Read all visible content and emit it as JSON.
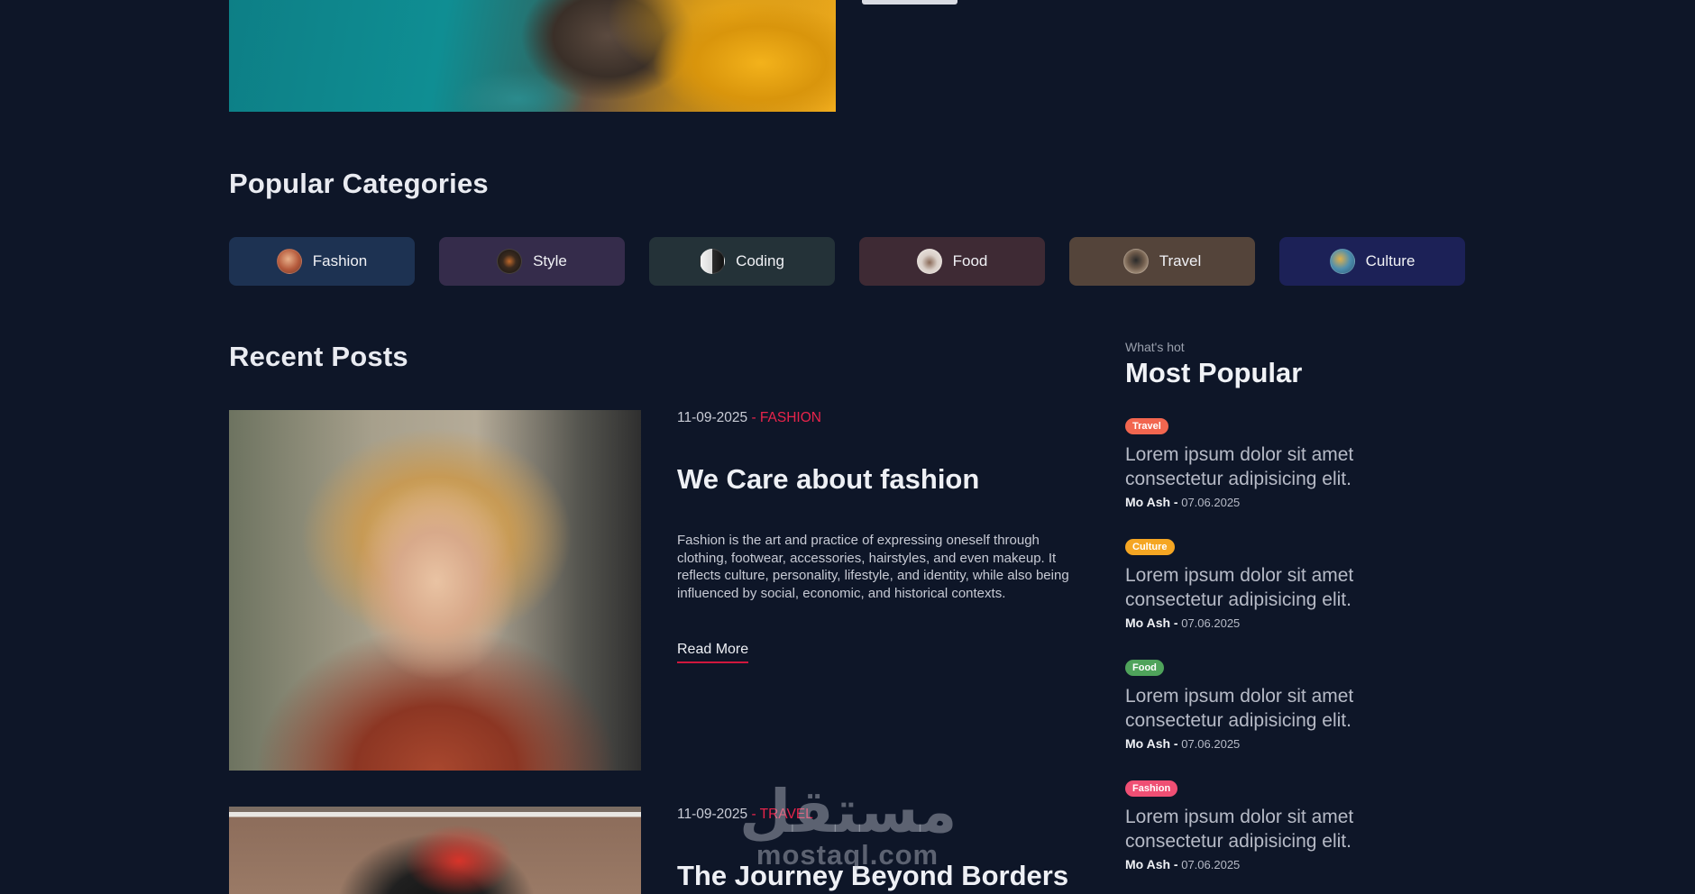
{
  "popular_categories": {
    "title": "Popular Categories",
    "items": [
      {
        "label": "Fashion",
        "bg": "#1d3252"
      },
      {
        "label": "Style",
        "bg": "#352c4b"
      },
      {
        "label": "Coding",
        "bg": "#243238"
      },
      {
        "label": "Food",
        "bg": "#3e2a34"
      },
      {
        "label": "Travel",
        "bg": "#54443a"
      },
      {
        "label": "Culture",
        "bg": "#1c2157"
      }
    ]
  },
  "recent_posts": {
    "title": "Recent Posts",
    "posts": [
      {
        "date": "11-09-2025",
        "category": "- FASHION",
        "title": "We Care about fashion",
        "excerpt": "Fashion is the art and practice of expressing oneself through clothing, footwear, accessories, hairstyles, and even makeup. It reflects culture, personality, lifestyle, and identity, while also being influenced by social, economic, and historical contexts.",
        "read_more": "Read More"
      },
      {
        "date": "11-09-2025",
        "category": "- TRAVEL",
        "title": "The Journey Beyond Borders"
      }
    ]
  },
  "sidebar": {
    "kicker": "What's hot",
    "title": "Most Popular",
    "items": [
      {
        "badge": "Travel",
        "badge_color": "#f2664f",
        "text": "Lorem ipsum dolor sit amet consectetur adipisicing elit.",
        "author": "Mo Ash -",
        "date": "07.06.2025"
      },
      {
        "badge": "Culture",
        "badge_color": "#f5a623",
        "text": "Lorem ipsum dolor sit amet consectetur adipisicing elit.",
        "author": "Mo Ash -",
        "date": "07.06.2025"
      },
      {
        "badge": "Food",
        "badge_color": "#4fa35b",
        "text": "Lorem ipsum dolor sit amet consectetur adipisicing elit.",
        "author": "Mo Ash -",
        "date": "07.06.2025"
      },
      {
        "badge": "Fashion",
        "badge_color": "#ef4f74",
        "text": "Lorem ipsum dolor sit amet consectetur adipisicing elit.",
        "author": "Mo Ash -",
        "date": "07.06.2025"
      }
    ]
  },
  "watermark": {
    "arabic": "مستقل",
    "latin": "mostaql.com"
  }
}
